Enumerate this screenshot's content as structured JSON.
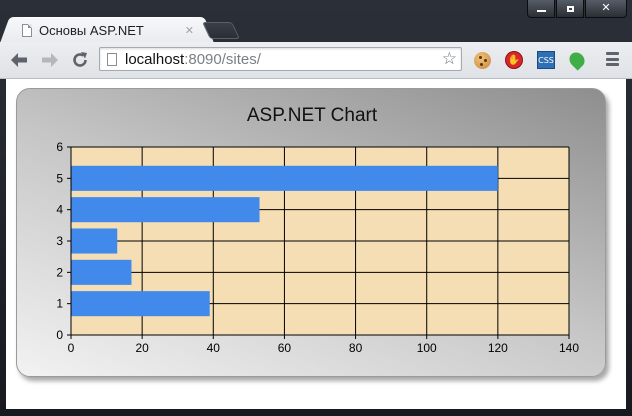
{
  "window": {
    "controls": {
      "minimize": "minimize",
      "maximize": "maximize",
      "close": "✕"
    }
  },
  "tabs": [
    {
      "title": "Основы ASP.NET",
      "close": "✕"
    }
  ],
  "toolbar": {
    "back_icon": "arrow-left-icon",
    "forward_icon": "arrow-right-icon",
    "reload_icon": "reload-icon",
    "address": {
      "host": "localhost",
      "rest": ":8090/sites/"
    },
    "extensions": [
      "cookie-icon",
      "stop-icon",
      "css-icon",
      "leaf-icon"
    ]
  },
  "colors": {
    "bar": "#4189eb",
    "plot_background": "#f5deb3",
    "grid": "#000000"
  },
  "chart_data": {
    "type": "bar",
    "orientation": "horizontal",
    "title": "ASP.NET Chart",
    "xlabel": "",
    "ylabel": "",
    "categories": [
      1,
      2,
      3,
      4,
      5
    ],
    "values": [
      39,
      17,
      13,
      53,
      120
    ],
    "xlim": [
      0,
      140
    ],
    "ylim": [
      0,
      6
    ],
    "x_ticks": [
      0,
      20,
      40,
      60,
      80,
      100,
      120,
      140
    ],
    "y_ticks": [
      0,
      1,
      2,
      3,
      4,
      5,
      6
    ],
    "grid": true,
    "legend": "none"
  }
}
